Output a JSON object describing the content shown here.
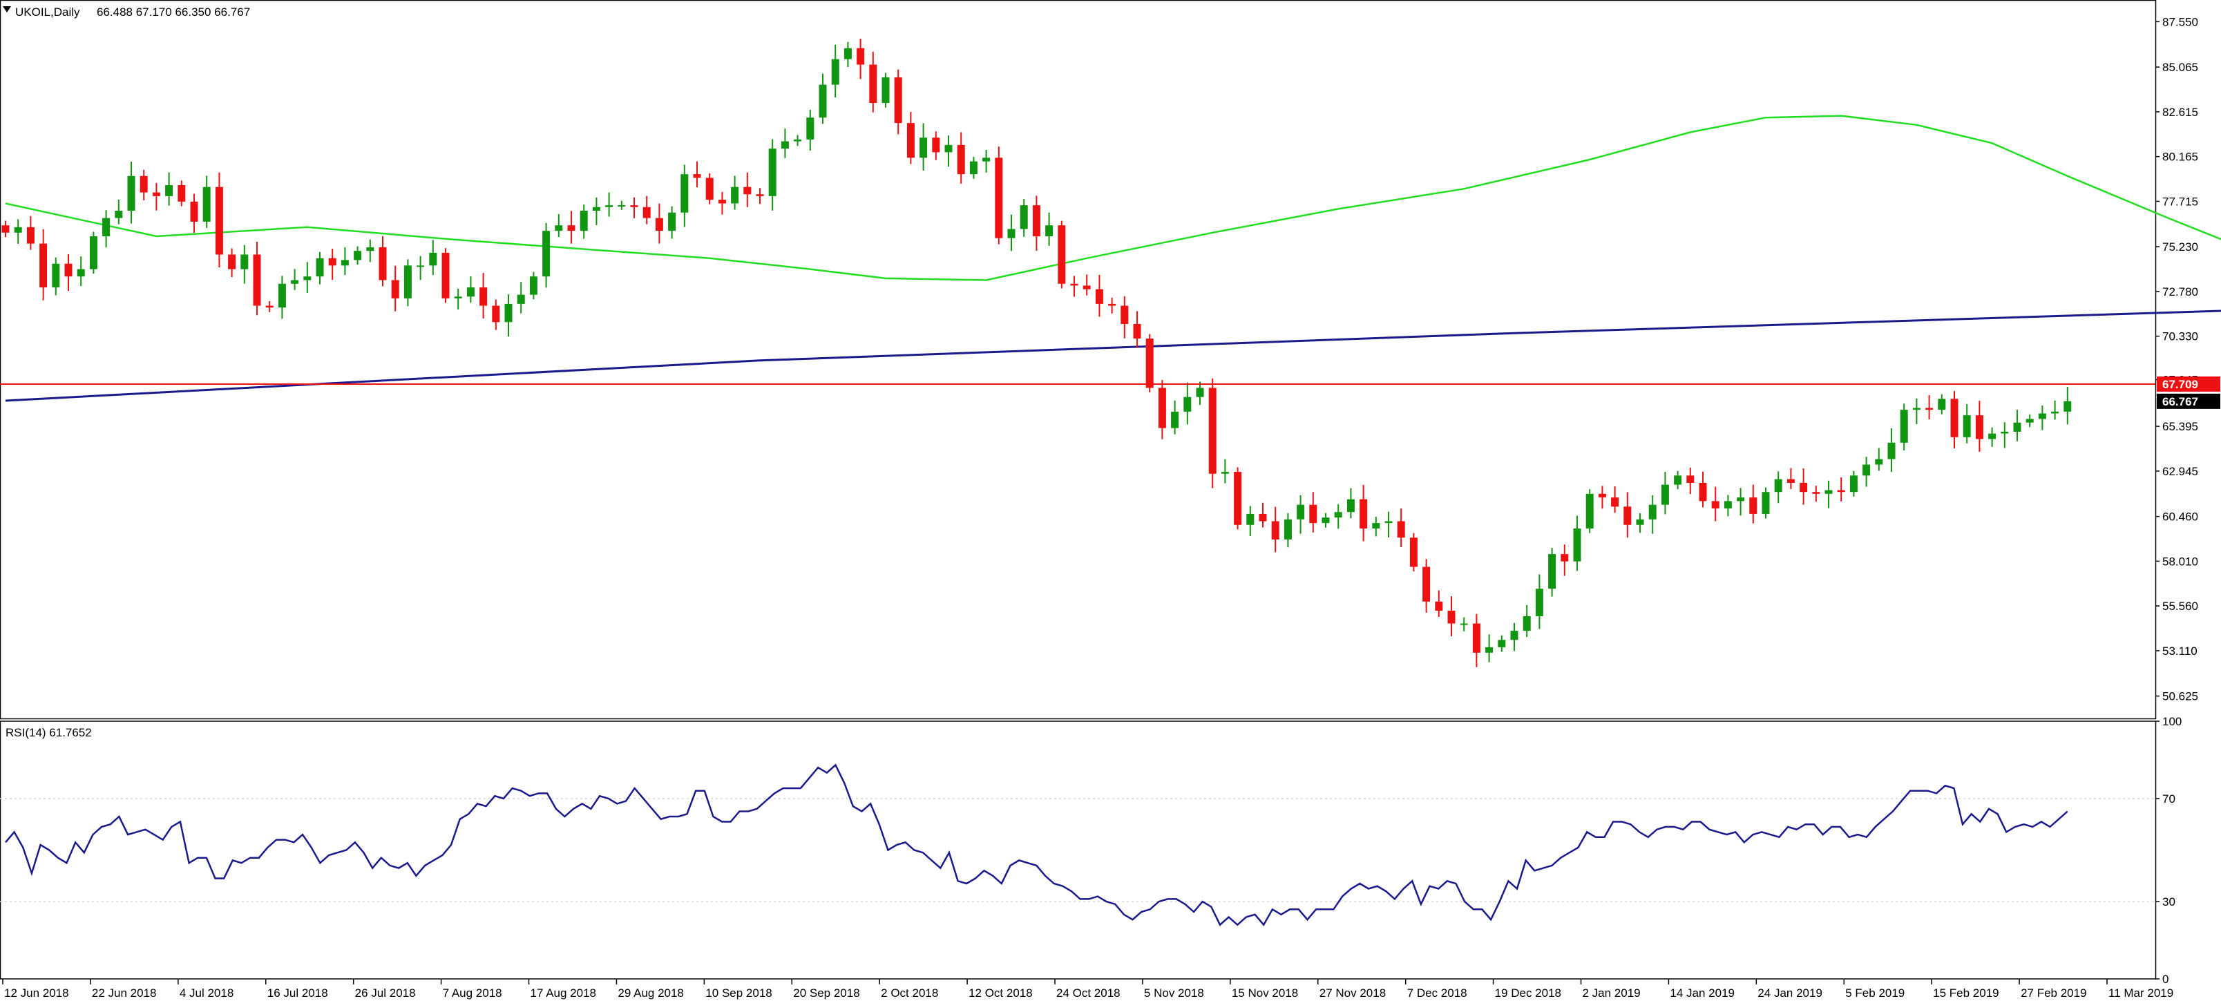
{
  "main_panel": {
    "symbol_label": "UKOIL,Daily",
    "ohlc_label": "66.488 67.170 66.350 66.767"
  },
  "rsi_panel": {
    "label": "RSI(14) 61.7652"
  },
  "colors": {
    "bull": "#109610",
    "bear": "#ee1111",
    "ma_fast": "#22dd22",
    "ma_slow": "#1a1a8c",
    "hline": "#ee1111",
    "rsi_line": "#1a1a8c",
    "last_price_bg": "#000000",
    "hline_tag_bg": "#ee1111",
    "grid": "#d8d8d8"
  },
  "chart_data": [
    {
      "type": "candlestick",
      "symbol": "UKOIL",
      "timeframe": "Daily",
      "ylim": [
        49.4,
        88.7
      ],
      "y_ticks": [
        "87.550",
        "85.065",
        "82.615",
        "80.165",
        "77.715",
        "75.230",
        "72.780",
        "70.330",
        "67.945",
        "65.395",
        "62.945",
        "60.460",
        "58.010",
        "55.560",
        "53.110",
        "50.625"
      ],
      "x_ticks": [
        "12 Jun 2018",
        "22 Jun 2018",
        "4 Jul 2018",
        "16 Jul 2018",
        "26 Jul 2018",
        "7 Aug 2018",
        "17 Aug 2018",
        "29 Aug 2018",
        "10 Sep 2018",
        "20 Sep 2018",
        "2 Oct 2018",
        "12 Oct 2018",
        "24 Oct 2018",
        "5 Nov 2018",
        "15 Nov 2018",
        "27 Nov 2018",
        "7 Dec 2018",
        "19 Dec 2018",
        "2 Jan 2019",
        "14 Jan 2019",
        "24 Jan 2019",
        "5 Feb 2019",
        "15 Feb 2019",
        "27 Feb 2019",
        "11 Mar 2019"
      ],
      "close": [
        76.0,
        76.3,
        75.4,
        73.0,
        74.3,
        73.6,
        74.0,
        75.8,
        76.8,
        77.2,
        79.1,
        78.2,
        78.0,
        78.6,
        77.7,
        76.6,
        78.5,
        74.8,
        74.0,
        74.8,
        72.0,
        71.9,
        73.2,
        73.4,
        73.6,
        74.6,
        74.2,
        74.5,
        75.0,
        75.2,
        73.4,
        72.4,
        74.2,
        74.2,
        74.9,
        72.4,
        72.5,
        73.0,
        72.0,
        71.1,
        72.1,
        72.6,
        73.6,
        76.1,
        76.4,
        76.1,
        77.2,
        77.4,
        77.5,
        77.5,
        77.4,
        76.8,
        76.1,
        77.1,
        79.2,
        79.0,
        77.8,
        77.6,
        78.5,
        78.1,
        78.0,
        80.6,
        81.0,
        81.1,
        82.3,
        84.1,
        85.5,
        86.1,
        85.2,
        83.1,
        84.5,
        82.0,
        80.1,
        81.2,
        80.4,
        80.8,
        79.2,
        79.9,
        80.1,
        75.7,
        76.2,
        77.5,
        75.8,
        76.4,
        73.2,
        73.1,
        72.9,
        72.1,
        72.0,
        71.0,
        70.2,
        67.5,
        65.3,
        66.2,
        67.0,
        67.5,
        62.8,
        62.9,
        60.0,
        60.6,
        60.2,
        59.2,
        60.3,
        61.1,
        60.1,
        60.4,
        60.7,
        61.4,
        59.8,
        60.1,
        60.2,
        59.3,
        57.7,
        55.8,
        55.3,
        54.6,
        54.6,
        53.0,
        53.3,
        53.7,
        54.2,
        55.0,
        56.5,
        58.4,
        58.0,
        59.8,
        61.7,
        61.5,
        61.0,
        60.0,
        60.3,
        61.1,
        62.2,
        62.7,
        62.3,
        61.3,
        60.9,
        61.3,
        61.5,
        60.6,
        61.8,
        62.5,
        62.3,
        61.8,
        61.7,
        61.9,
        61.8,
        62.7,
        63.3,
        63.6,
        64.5,
        66.3,
        66.4,
        66.3,
        66.9,
        64.8,
        66.0,
        64.7,
        65.0,
        65.1,
        65.6,
        65.8,
        66.1,
        66.2,
        66.77
      ],
      "series": [
        {
          "name": "",
          "color_key": "ma_fast",
          "points": [
            [
              0,
              77.6
            ],
            [
              12,
              75.8
            ],
            [
              24,
              76.3
            ],
            [
              36,
              75.6
            ],
            [
              48,
              75.0
            ],
            [
              56,
              74.6
            ],
            [
              64,
              74.0
            ],
            [
              70,
              73.5
            ],
            [
              78,
              73.4
            ],
            [
              86,
              74.6
            ],
            [
              96,
              76.0
            ],
            [
              106,
              77.3
            ],
            [
              116,
              78.4
            ],
            [
              126,
              80.0
            ],
            [
              134,
              81.5
            ],
            [
              140,
              82.3
            ],
            [
              146,
              82.4
            ],
            [
              152,
              81.9
            ],
            [
              158,
              80.9
            ],
            [
              164,
              79.1
            ],
            [
              172,
              76.8
            ],
            [
              180,
              74.6
            ],
            [
              186,
              72.8
            ],
            [
              192,
              70.8
            ],
            [
              198,
              68.7
            ],
            [
              204,
              66.4
            ],
            [
              212,
              64.0
            ],
            [
              222,
              62.0
            ],
            [
              234,
              60.8
            ],
            [
              244,
              59.6
            ],
            [
              254,
              58.6
            ],
            [
              264,
              57.4
            ],
            [
              274,
              56.6
            ],
            [
              284,
              56.3
            ],
            [
              294,
              56.2
            ],
            [
              306,
              56.4
            ],
            [
              318,
              57.4
            ],
            [
              330,
              59.2
            ],
            [
              346,
              60.6
            ],
            [
              358,
              61.5
            ],
            [
              368,
              62.1
            ],
            [
              376,
              62.3
            ],
            [
              388,
              62.5
            ],
            [
              400,
              62.8
            ],
            [
              412,
              63.6
            ],
            [
              424,
              64.6
            ],
            [
              436,
              65.0
            ],
            [
              448,
              65.5
            ],
            [
              458,
              65.9
            ]
          ]
        },
        {
          "name": "",
          "color_key": "ma_slow",
          "points": [
            [
              0,
              66.8
            ],
            [
              60,
              69.0
            ],
            [
              120,
              70.5
            ],
            [
              180,
              71.8
            ],
            [
              240,
              72.9
            ],
            [
              300,
              73.6
            ],
            [
              360,
              74.2
            ],
            [
              420,
              74.1
            ],
            [
              480,
              73.7
            ],
            [
              540,
              73.0
            ],
            [
              600,
              72.2
            ],
            [
              660,
              71.5
            ],
            [
              720,
              70.9
            ],
            [
              780,
              70.3
            ],
            [
              828,
              69.9
            ]
          ]
        }
      ],
      "horizontal_line": {
        "value": 67.709,
        "label": "67.709"
      },
      "last_price": {
        "value": 66.767,
        "label": "66.767"
      }
    },
    {
      "type": "line",
      "name": "RSI(14)",
      "ylim": [
        0,
        100
      ],
      "y_ticks": [
        "100",
        "70",
        "30",
        "0"
      ],
      "levels": [
        70,
        30
      ],
      "values": [
        53,
        57,
        51,
        41,
        52,
        50,
        47,
        45,
        53,
        49,
        56,
        59,
        60,
        63,
        56,
        57,
        58,
        56,
        54,
        59,
        61,
        45,
        47,
        47,
        39,
        39,
        46,
        45,
        47,
        47,
        51,
        54,
        54,
        53,
        56,
        51,
        45,
        48,
        49,
        50,
        53,
        49,
        43,
        47,
        44,
        43,
        45,
        40,
        44,
        46,
        48,
        52,
        62,
        64,
        68,
        67,
        71,
        70,
        74,
        73,
        71,
        72,
        72,
        66,
        63,
        66,
        68,
        66,
        71,
        70,
        68,
        69,
        74,
        70,
        66,
        62,
        63,
        63,
        64,
        73,
        73,
        63,
        61,
        61,
        65,
        65,
        66,
        69,
        72,
        74,
        74,
        74,
        78,
        82,
        80,
        83,
        76,
        67,
        65,
        68,
        60,
        50,
        52,
        53,
        50,
        49,
        46,
        43,
        49,
        38,
        37,
        39,
        42,
        40,
        37,
        44,
        46,
        45,
        44,
        40,
        37,
        36,
        34,
        31,
        31,
        32,
        30,
        29,
        25,
        23,
        26,
        27,
        30,
        31,
        31,
        29,
        26,
        30,
        28,
        21,
        24,
        21,
        24,
        25,
        21,
        27,
        25,
        27,
        27,
        23,
        27,
        27,
        27,
        32,
        35,
        37,
        35,
        36,
        34,
        31,
        35,
        38,
        29,
        36,
        35,
        38,
        37,
        30,
        27,
        27,
        23,
        30,
        38,
        35,
        46,
        42,
        43,
        44,
        47,
        49,
        51,
        57,
        55,
        55,
        61,
        61,
        60,
        57,
        55,
        58,
        59,
        59,
        58,
        61,
        61,
        58,
        57,
        56,
        57,
        53,
        56,
        57,
        56,
        55,
        59,
        58,
        60,
        60,
        56,
        59,
        59,
        55,
        56,
        55,
        59,
        62,
        65,
        69,
        73,
        73,
        73,
        72,
        75,
        74,
        60,
        64,
        61,
        66,
        64,
        57,
        59,
        60,
        59,
        61,
        59,
        62,
        65
      ],
      "title": "RSI(14) 61.7652"
    }
  ]
}
